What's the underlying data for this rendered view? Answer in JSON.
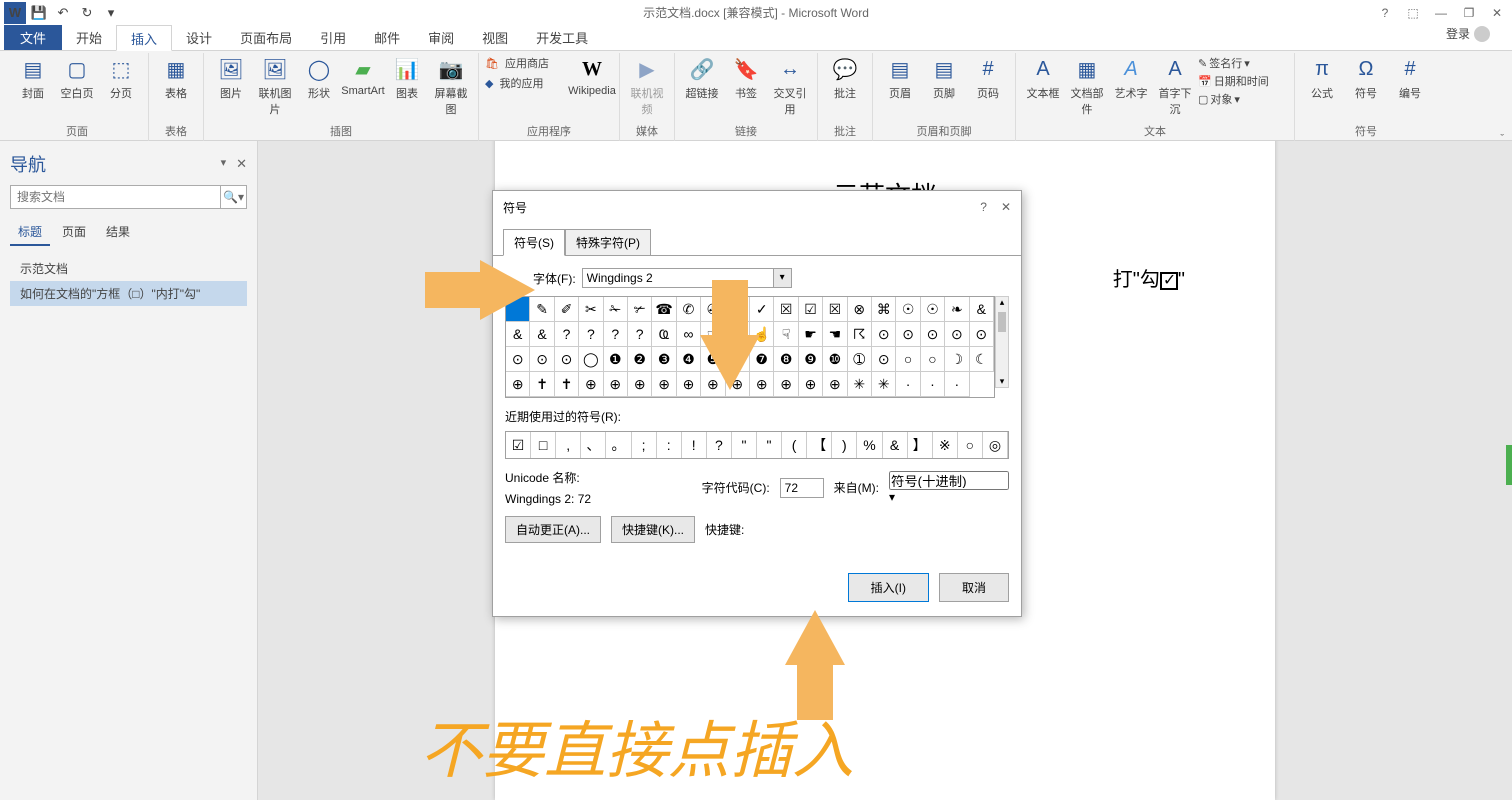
{
  "titlebar": {
    "title": "示范文档.docx [兼容模式] - Microsoft Word",
    "help": "?",
    "ribbon_opts": "⬚",
    "minimize": "—",
    "maximize": "❐",
    "close": "✕"
  },
  "tabs": {
    "file": "文件",
    "home": "开始",
    "insert": "插入",
    "design": "设计",
    "layout": "页面布局",
    "references": "引用",
    "mail": "邮件",
    "review": "审阅",
    "view": "视图",
    "dev": "开发工具",
    "login": "登录"
  },
  "ribbon": {
    "pages": {
      "label": "页面",
      "cover": "封面",
      "blank": "空白页",
      "break": "分页"
    },
    "tables": {
      "label": "表格",
      "table": "表格"
    },
    "illustrations": {
      "label": "插图",
      "picture": "图片",
      "online_pic": "联机图片",
      "shapes": "形状",
      "smartart": "SmartArt",
      "chart": "图表",
      "screenshot": "屏幕截图"
    },
    "apps": {
      "label": "应用程序",
      "store": "应用商店",
      "my_apps": "我的应用",
      "wikipedia": "Wikipedia"
    },
    "media": {
      "label": "媒体",
      "online_video": "联机视频"
    },
    "links": {
      "label": "链接",
      "hyperlink": "超链接",
      "bookmark": "书签",
      "cross_ref": "交叉引用"
    },
    "comments": {
      "label": "批注",
      "comment": "批注"
    },
    "header_footer": {
      "label": "页眉和页脚",
      "header": "页眉",
      "footer": "页脚",
      "page_num": "页码"
    },
    "text": {
      "label": "文本",
      "textbox": "文本框",
      "quick_parts": "文档部件",
      "wordart": "艺术字",
      "drop_cap": "首字下沉",
      "sig_line": "签名行",
      "date_time": "日期和时间",
      "object": "对象"
    },
    "symbols": {
      "label": "符号",
      "equation": "公式",
      "symbol": "符号",
      "number": "编号"
    }
  },
  "nav": {
    "title": "导航",
    "search_placeholder": "搜索文档",
    "tab_headings": "标题",
    "tab_pages": "页面",
    "tab_results": "结果",
    "item1": "示范文档",
    "item2": "如何在文档的\"方框（□）\"内打\"勾\""
  },
  "document": {
    "heading": "示范文档",
    "body_prefix": "打\"勾",
    "body_suffix": "\""
  },
  "dialog": {
    "title": "符号",
    "tab_symbols": "符号(S)",
    "tab_special": "特殊字符(P)",
    "font_label": "字体(F):",
    "font_value": "Wingdings 2",
    "recent_label": "近期使用过的符号(R):",
    "unicode_label": "Unicode 名称:",
    "font_desc": "Wingdings 2: 72",
    "char_code_label": "字符代码(C):",
    "char_code_value": "72",
    "from_label": "来自(M):",
    "from_value": "符号(十进制)",
    "autocorrect": "自动更正(A)...",
    "shortcut_key": "快捷键(K)...",
    "shortcut_label": "快捷键:",
    "insert": "插入(I)",
    "cancel": "取消"
  },
  "symbol_grid_rows": [
    [
      "",
      "✎",
      "✐",
      "✂",
      "✁",
      "✃",
      "☎",
      "✆",
      "✇",
      "×",
      "✓",
      "☒",
      "☑",
      "☒",
      "⊗",
      "⌘",
      "☉",
      "☉",
      "❧",
      "&",
      "&"
    ],
    [
      "&",
      "?",
      "?",
      "?",
      "?",
      "Ҩ",
      "∞",
      "☞",
      "☜",
      "☝",
      "☟",
      "☛",
      "☚",
      "☈",
      "⊙",
      "⊙",
      "⊙",
      "⊙",
      "⊙",
      "⊙"
    ],
    [
      "⊙",
      "⊙",
      "◯",
      "❶",
      "❷",
      "❸",
      "❹",
      "❺",
      "❻",
      "❼",
      "❽",
      "❾",
      "❿",
      "➀",
      "⊙",
      "○",
      "○",
      "☽",
      "☾"
    ],
    [
      "⊕",
      "✝",
      "✝",
      "⊕",
      "⊕",
      "⊕",
      "⊕",
      "⊕",
      "⊕",
      "⊕",
      "⊕",
      "⊕",
      "⊕",
      "⊕",
      "✳",
      "✳",
      "·",
      "·",
      "·"
    ]
  ],
  "recent_symbols": [
    "☑",
    "□",
    ",",
    "、",
    "。",
    ";",
    ":",
    "!",
    "?",
    "\"",
    "\"",
    "(",
    "【",
    ")",
    "%",
    "&",
    "】",
    "※",
    "○",
    "◎"
  ],
  "annotation": "不要直接点插入"
}
